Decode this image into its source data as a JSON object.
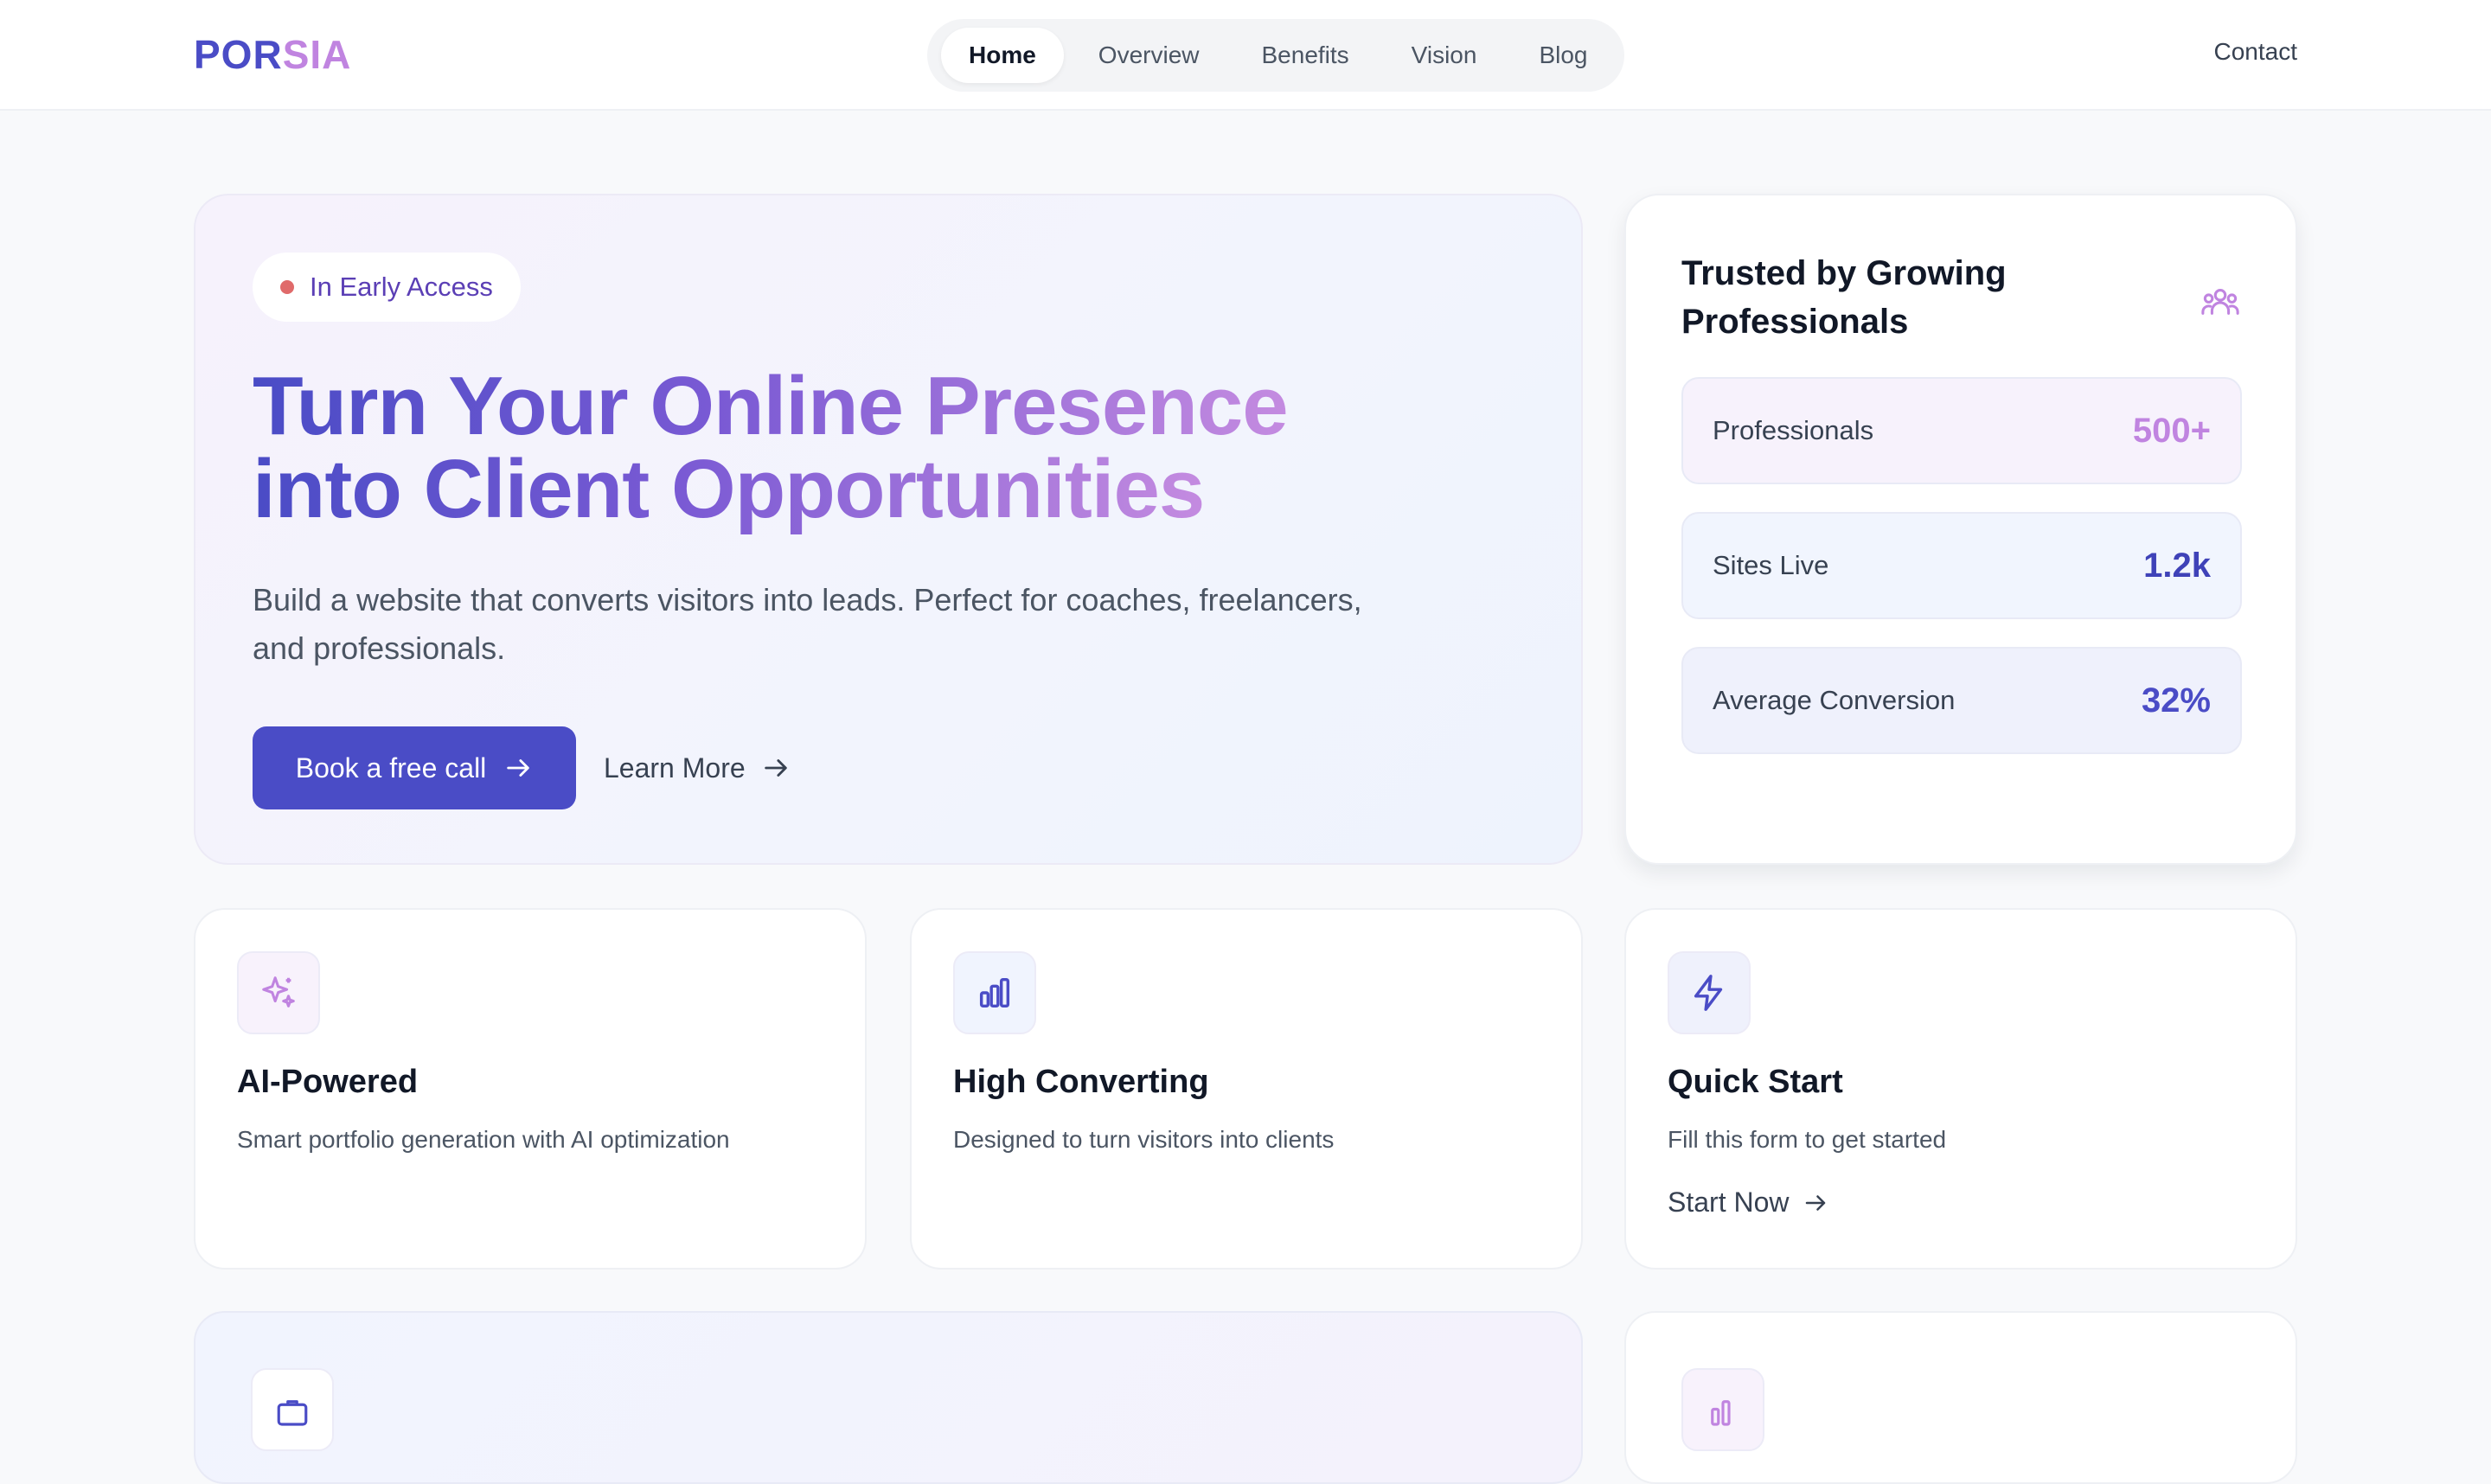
{
  "brand": {
    "part1": "POR",
    "part2": "SIA"
  },
  "nav": {
    "items": [
      {
        "label": "Home",
        "active": true
      },
      {
        "label": "Overview",
        "active": false
      },
      {
        "label": "Benefits",
        "active": false
      },
      {
        "label": "Vision",
        "active": false
      },
      {
        "label": "Blog",
        "active": false
      }
    ],
    "contact": "Contact"
  },
  "hero": {
    "badge": "In Early Access",
    "title_line1": "Turn Your Online Presence",
    "title_line2": "into Client Opportunities",
    "subtitle": "Build a website that converts visitors into leads. Perfect for coaches, freelancers, and professionals.",
    "primary_cta": "Book a free call",
    "secondary_cta": "Learn More"
  },
  "stats": {
    "title": "Trusted by Growing Professionals",
    "icon": "users-group-icon",
    "rows": [
      {
        "label": "Professionals",
        "value": "500+"
      },
      {
        "label": "Sites Live",
        "value": "1.2k"
      },
      {
        "label": "Average Conversion",
        "value": "32%"
      }
    ]
  },
  "features": [
    {
      "icon": "sparkles-icon",
      "title": "AI-Powered",
      "description": "Smart portfolio generation with AI optimization"
    },
    {
      "icon": "bar-chart-icon",
      "title": "High Converting",
      "description": "Designed to turn visitors into clients"
    },
    {
      "icon": "lightning-icon",
      "title": "Quick Start",
      "description": "Fill this form to get started",
      "link": "Start Now"
    }
  ],
  "colors": {
    "primary": "#4a4cc6",
    "accent": "#c084e0",
    "badge_dot": "#e06a6a",
    "background": "#f8f9fb"
  }
}
